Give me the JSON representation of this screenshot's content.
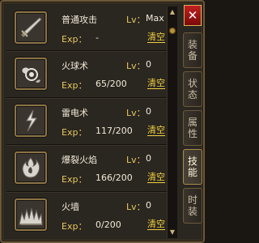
{
  "close_label": "✕",
  "labels": {
    "lv": "Lv：",
    "exp": "Exp：",
    "clear": "清空"
  },
  "skills": [
    {
      "name": "普通攻击",
      "level": "Max",
      "exp": "-",
      "icon": "sword-icon"
    },
    {
      "name": "火球术",
      "level": "0",
      "exp": "65/200",
      "icon": "fireball-icon"
    },
    {
      "name": "雷电术",
      "level": "0",
      "exp": "117/200",
      "icon": "lightning-icon"
    },
    {
      "name": "爆裂火焰",
      "level": "0",
      "exp": "166/200",
      "icon": "explosive-flame-icon"
    },
    {
      "name": "火墙",
      "level": "0",
      "exp": "0/200",
      "icon": "fire-wall-icon"
    }
  ],
  "tabs": [
    {
      "label": "装备",
      "active": false
    },
    {
      "label": "状态",
      "active": false
    },
    {
      "label": "属性",
      "active": false
    },
    {
      "label": "技能",
      "active": true
    },
    {
      "label": "时装",
      "active": false
    }
  ],
  "colors": {
    "accent": "#e8c860",
    "clear_link": "#f0d040",
    "close": "#c02020"
  }
}
